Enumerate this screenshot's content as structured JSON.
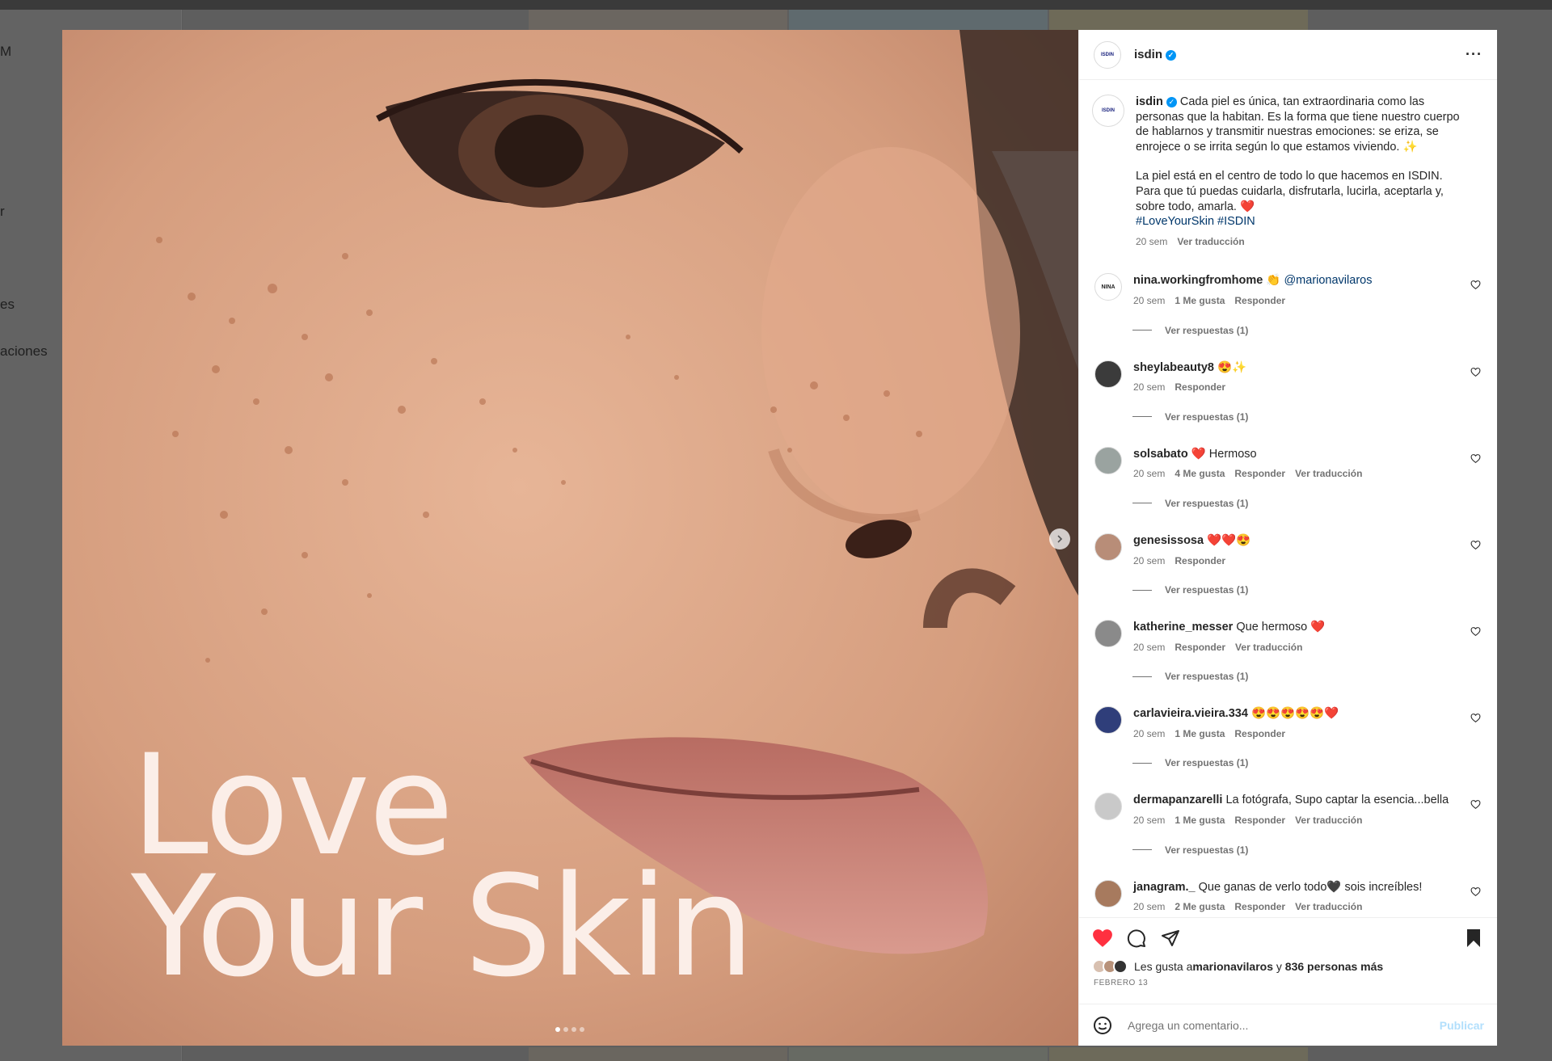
{
  "background": {
    "nav_fragments": [
      "M",
      "r",
      "es",
      "aciones"
    ]
  },
  "post": {
    "image_text": [
      "Love",
      "Your Skin"
    ],
    "carousel_count": 4
  },
  "header": {
    "avatar_text": "ISDIN",
    "username": "isdin",
    "more": "···"
  },
  "caption": {
    "username": "isdin",
    "paragraph1": "Cada piel es única, tan extraordinaria como las personas que la habitan. Es la forma que tiene nuestro cuerpo de hablarnos y transmitir nuestras emociones: se eriza, se enrojece o se irrita según lo que estamos viviendo. ✨",
    "paragraph2": "La piel está en el centro de todo lo que hacemos en ISDIN. Para que tú puedas cuidarla, disfrutarla, lucirla, aceptarla y, sobre todo, amarla. ❤️",
    "hashtags": "#LoveYourSkin #ISDIN",
    "time": "20 sem",
    "translate": "Ver traducción"
  },
  "comments": [
    {
      "username": "nina.workingfromhome",
      "text": "👏 ",
      "mention": "@marionavilaros",
      "time": "20 sem",
      "likes": "1 Me gusta",
      "reply": "Responder",
      "translate": "",
      "replies": "Ver respuestas (1)",
      "avatar_text": "NINA",
      "avatar_bg": "#ffffff"
    },
    {
      "username": "sheylabeauty8",
      "text": "😍✨",
      "mention": "",
      "time": "20 sem",
      "likes": "",
      "reply": "Responder",
      "translate": "",
      "replies": "Ver respuestas (1)",
      "avatar_text": "",
      "avatar_bg": "#3b3b3b"
    },
    {
      "username": "solsabato",
      "text": "❤️ Hermoso",
      "mention": "",
      "time": "20 sem",
      "likes": "4 Me gusta",
      "reply": "Responder",
      "translate": "Ver traducción",
      "replies": "Ver respuestas (1)",
      "avatar_text": "",
      "avatar_bg": "#9aa3a0"
    },
    {
      "username": "genesissosa",
      "text": "❤️❤️😍",
      "mention": "",
      "time": "20 sem",
      "likes": "",
      "reply": "Responder",
      "translate": "",
      "replies": "Ver respuestas (1)",
      "avatar_text": "",
      "avatar_bg": "#b88d78"
    },
    {
      "username": "katherine_messer",
      "text": "Que hermoso ❤️",
      "mention": "",
      "time": "20 sem",
      "likes": "",
      "reply": "Responder",
      "translate": "Ver traducción",
      "replies": "Ver respuestas (1)",
      "avatar_text": "",
      "avatar_bg": "#8a8a8a"
    },
    {
      "username": "carlavieira.vieira.334",
      "text": "😍😍😍😍😍❤️",
      "mention": "",
      "time": "20 sem",
      "likes": "1 Me gusta",
      "reply": "Responder",
      "translate": "",
      "replies": "Ver respuestas (1)",
      "avatar_text": "",
      "avatar_bg": "#2f3e7a"
    },
    {
      "username": "dermapanzarelli",
      "text": "La fotógrafa, Supo captar la esencia...bella",
      "mention": "",
      "time": "20 sem",
      "likes": "1 Me gusta",
      "reply": "Responder",
      "translate": "Ver traducción",
      "replies": "Ver respuestas (1)",
      "avatar_text": "",
      "avatar_bg": "#c9c9c9"
    },
    {
      "username": "janagram._",
      "text": "Que ganas de verlo todo🖤 sois increíbles!",
      "mention": "",
      "time": "20 sem",
      "likes": "2 Me gusta",
      "reply": "Responder",
      "translate": "Ver traducción",
      "replies": "",
      "avatar_text": "",
      "avatar_bg": "#a77a5e"
    }
  ],
  "likes": {
    "prefix": "Les gusta a ",
    "user": "marionavilaros",
    "middle": " y ",
    "others": "836 personas más"
  },
  "date": "FEBRERO 13",
  "add_comment": {
    "placeholder": "Agrega un comentario...",
    "publish": "Publicar"
  },
  "colors": {
    "like_red": "#ff3040",
    "link_blue": "#00376b",
    "verified_blue": "#0095f6",
    "publish_disabled": "#b2dffc"
  }
}
